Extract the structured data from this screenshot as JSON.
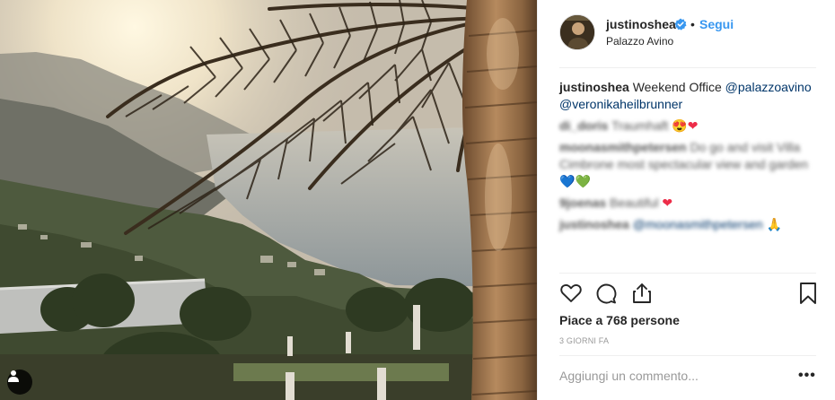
{
  "post": {
    "username": "justinoshea",
    "follow_label": "Segui",
    "dot": "•",
    "location": "Palazzo Avino",
    "verified_icon": "verified-badge-icon",
    "accent_color": "#3897f0"
  },
  "caption": {
    "username": "justinoshea",
    "text": "Weekend Office",
    "mention1": "@palazzoavino",
    "mention2": "@veronikaheilbrunner"
  },
  "comments": [
    {
      "user": "di_doris",
      "text": "Traumhaft",
      "emoji": "😍",
      "emoji2": "❤"
    },
    {
      "user": "moonasmithpetersen",
      "text": "Do go and visit Villa Cimbrone most spectacular view and garden",
      "emoji": "💙",
      "emoji2": "💚"
    },
    {
      "user": "9joenas",
      "text": "Beautiful",
      "emoji": "❤",
      "emoji2": ""
    },
    {
      "user": "justinoshea",
      "text": "@moonasmithpetersen",
      "emoji": "🙏",
      "emoji2": ""
    }
  ],
  "actions": {
    "like_icon": "heart-icon",
    "comment_icon": "comment-icon",
    "share_icon": "share-icon",
    "save_icon": "bookmark-icon"
  },
  "likes_text": "Piace a 768 persone",
  "time_text": "3 GIORNI FA",
  "comment_placeholder": "Aggiungi un commento...",
  "more_label": "•••"
}
